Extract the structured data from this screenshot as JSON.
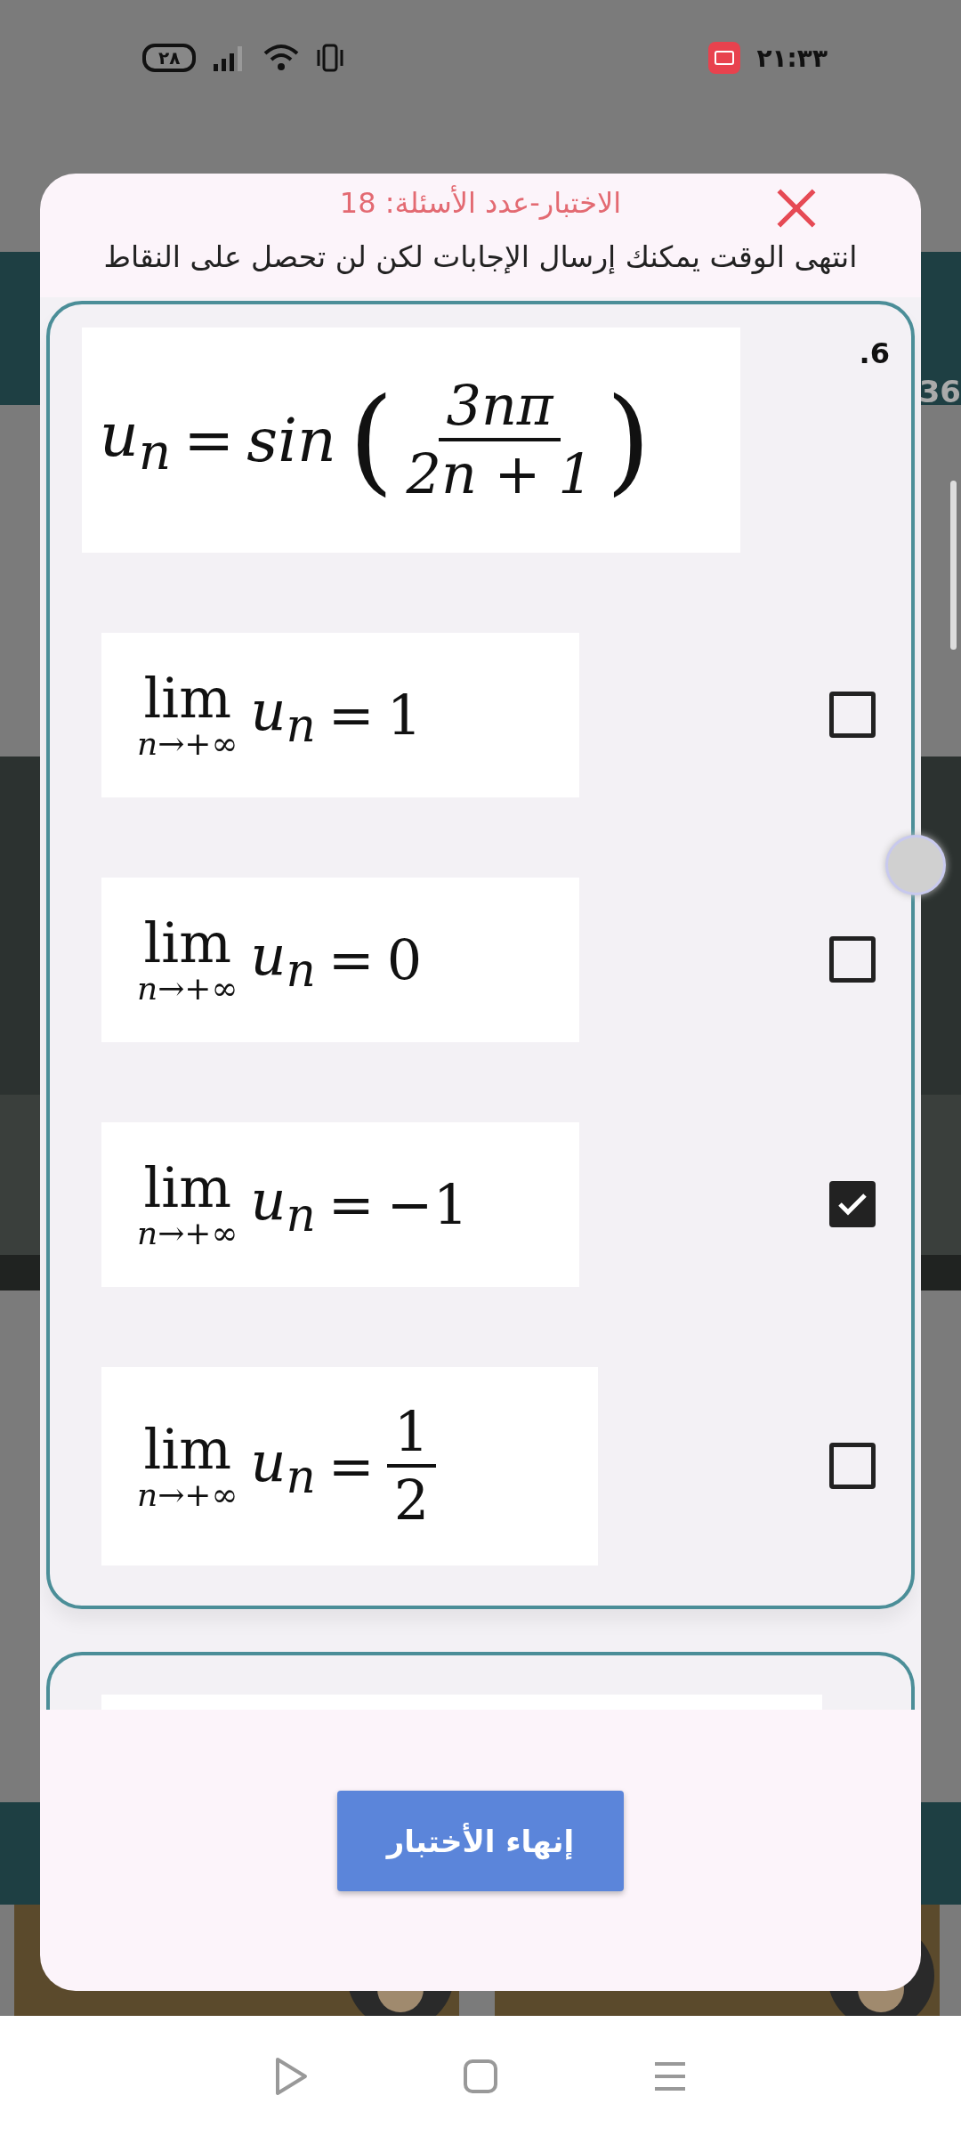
{
  "status_bar": {
    "time": "٢١:٣٣",
    "battery": "٢٨"
  },
  "background": {
    "counter": "36"
  },
  "dialog": {
    "title": "الاختبار-عدد الأسئلة: 18",
    "message": "انتهى الوقت يمكنك إرسال الإجابات لكن لن تحصل على النقاط",
    "question": {
      "number": ".6",
      "formula": {
        "lhs": "u$_{n}$",
        "equals": "=",
        "function": "sin",
        "open": "(",
        "numerator": "3nπ",
        "denominator": "2n + 1",
        "close": ")"
      },
      "options": [
        {
          "kind": "number",
          "operator": "lim",
          "limit": "n→+∞",
          "term": "u$_{n}$",
          "equals": "=",
          "value": "1",
          "checked": false
        },
        {
          "kind": "number",
          "operator": "lim",
          "limit": "n→+∞",
          "term": "u$_{n}$",
          "equals": "=",
          "value": "0",
          "checked": false
        },
        {
          "kind": "number",
          "operator": "lim",
          "limit": "n→+∞",
          "term": "u$_{n}$",
          "equals": "=",
          "value": "−1",
          "checked": true
        },
        {
          "kind": "fraction",
          "operator": "lim",
          "limit": "n→+∞",
          "term": "u$_{n}$",
          "equals": "=",
          "numerator": "1",
          "denominator": "2",
          "checked": false
        }
      ]
    },
    "finish_button": "إنهاء الأختبار"
  }
}
